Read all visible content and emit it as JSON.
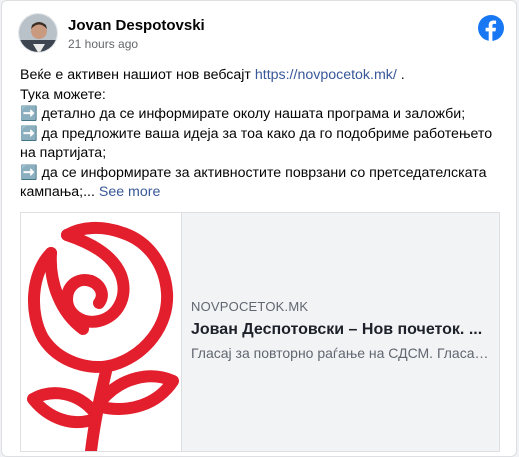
{
  "post": {
    "author": "Jovan Despotovski",
    "time": "21 hours ago",
    "lines": [
      "Веќе е активен нашиот нов вебсајт ",
      "Тука можете:",
      "➡️ детално да се информирате околу нашата програма и заложби;",
      "➡️ да предложите ваша идеја за тоа како да го подобриме работењето на партијата;",
      "➡️ да се информирате за активностите поврзани со претседателската кампања;..."
    ],
    "link_text": "https://novpocetok.mk/",
    "link_suffix": " .",
    "see_more": "See more"
  },
  "preview": {
    "domain": "NOVPOCETOK.MK",
    "title": "Јован Деспотовски – Нов почеток. ...",
    "description": "Гласај за повторно раѓање на СДСМ. Гласај за Јован"
  },
  "colors": {
    "brand_blue": "#1877f2",
    "link": "#385898",
    "rose_red": "#e31e2d"
  }
}
